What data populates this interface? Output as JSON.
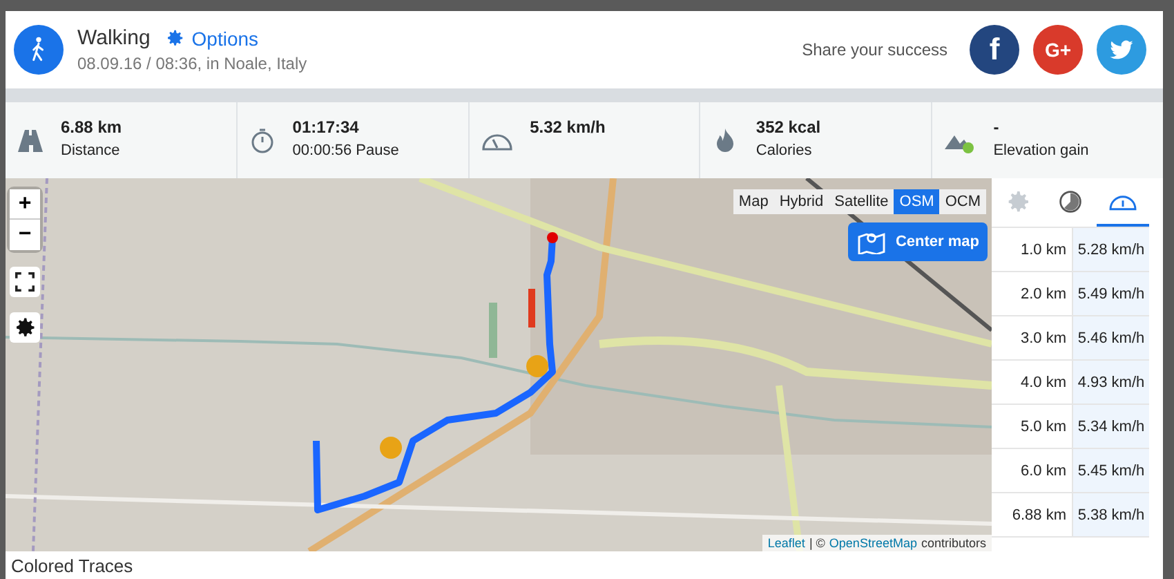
{
  "header": {
    "activity": "Walking",
    "options": "Options",
    "subtitle": "08.09.16 / 08:36, in Noale, Italy",
    "share_label": "Share your success",
    "share_buttons": [
      {
        "kind": "facebook",
        "label": "f"
      },
      {
        "kind": "google",
        "label": "G+"
      },
      {
        "kind": "twitter"
      }
    ]
  },
  "stats": [
    {
      "kind": "road",
      "value": "6.88 km",
      "label": "Distance"
    },
    {
      "kind": "stopwatch",
      "value": "01:17:34",
      "label": "00:00:56 Pause"
    },
    {
      "kind": "speedometer",
      "value": "5.32 km/h"
    },
    {
      "kind": "flame",
      "value": "352 kcal",
      "label": "Calories"
    },
    {
      "kind": "mountain",
      "value": "-",
      "label": "Elevation gain"
    }
  ],
  "map": {
    "zoom_in": "+",
    "zoom_out": "−",
    "layers": [
      {
        "label": "Map",
        "selected": false
      },
      {
        "label": "Hybrid",
        "selected": false
      },
      {
        "label": "Satellite",
        "selected": false
      },
      {
        "label": "OSM",
        "selected": true
      },
      {
        "label": "OCM",
        "selected": false
      }
    ],
    "center_button": "Center map",
    "attribution": {
      "link1": "Leaflet",
      "separator": "| ©",
      "link2": "OpenStreetMap",
      "suffix": "contributors"
    }
  },
  "panel": {
    "tabs": [
      {
        "kind": "gear",
        "selected": false
      },
      {
        "kind": "pie",
        "selected": false
      },
      {
        "kind": "speedometer",
        "selected": true
      }
    ],
    "rows": [
      {
        "distance": "1.0 km",
        "speed": "5.28 km/h"
      },
      {
        "distance": "2.0 km",
        "speed": "5.49 km/h"
      },
      {
        "distance": "3.0 km",
        "speed": "5.46 km/h"
      },
      {
        "distance": "4.0 km",
        "speed": "4.93 km/h"
      },
      {
        "distance": "5.0 km",
        "speed": "5.34 km/h"
      },
      {
        "distance": "6.0 km",
        "speed": "5.45 km/h"
      },
      {
        "distance": "6.88 km",
        "speed": "5.38 km/h"
      }
    ]
  },
  "footer": {
    "title": "Colored Traces"
  }
}
